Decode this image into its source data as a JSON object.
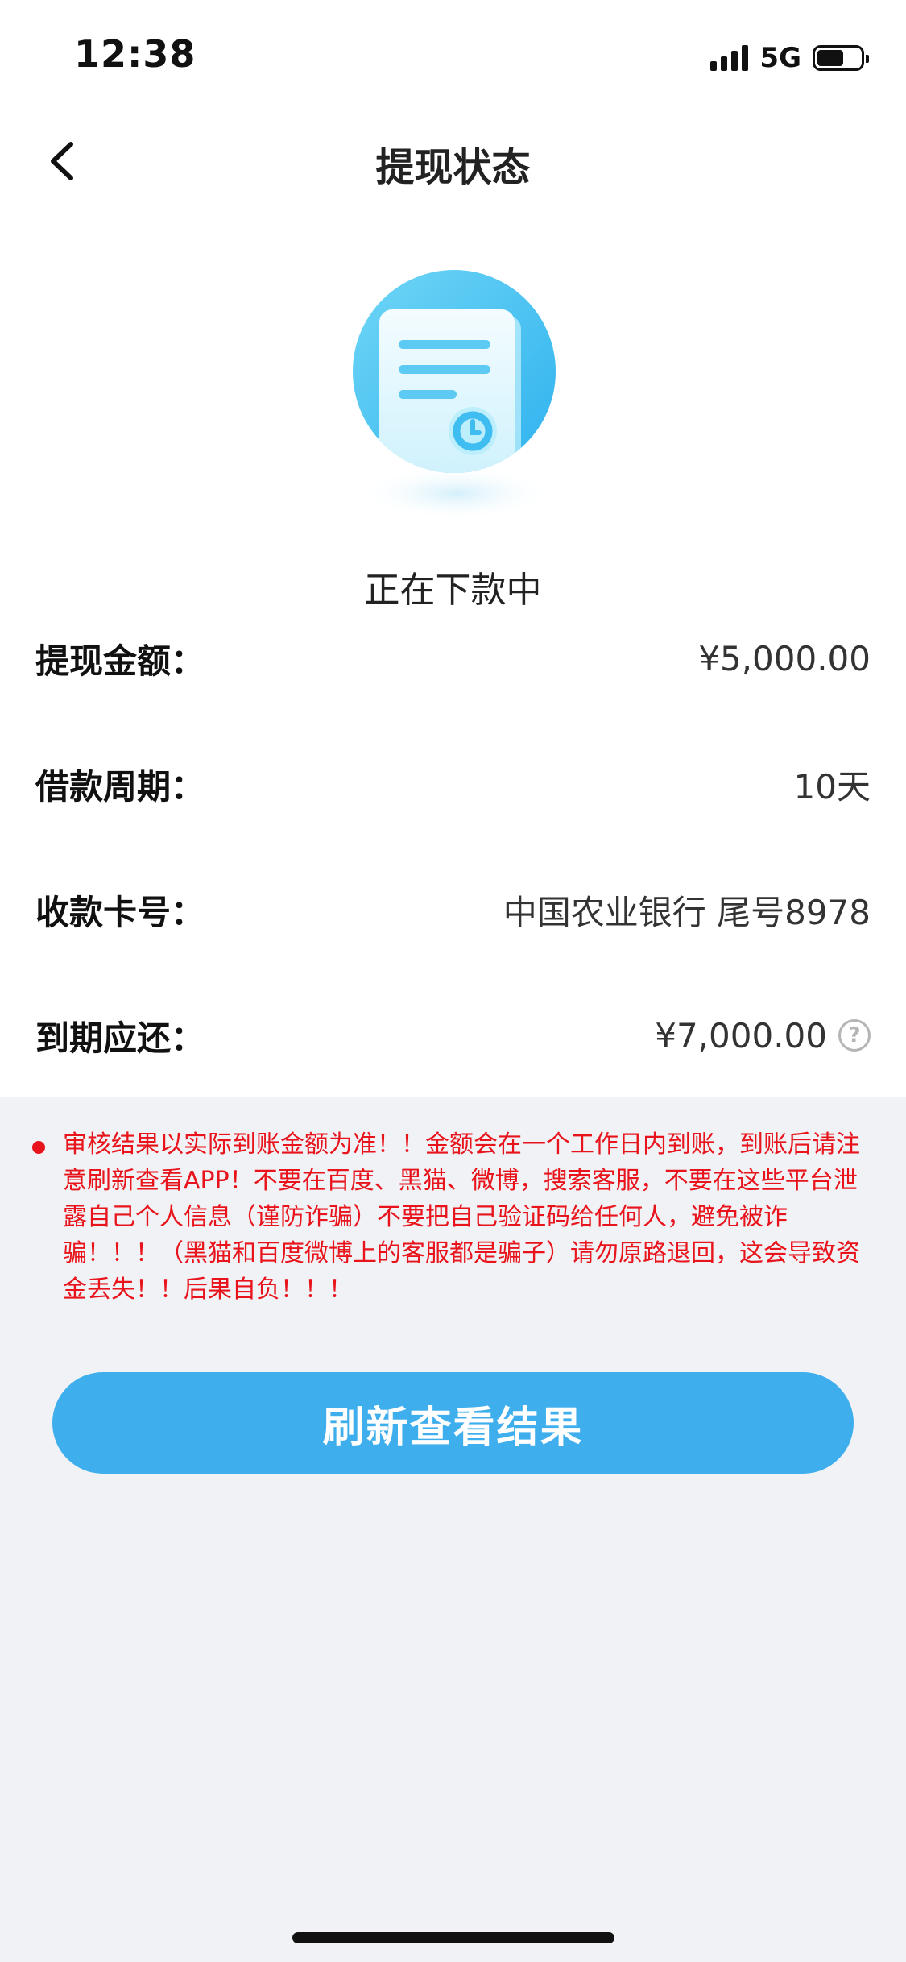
{
  "status_bar": {
    "time": "12:38",
    "network": "5G"
  },
  "nav": {
    "title": "提现状态"
  },
  "status": {
    "icon": "document-clock-icon",
    "text": "正在下款中"
  },
  "info_rows": [
    {
      "label": "提现金额：",
      "value": "¥5,000.00"
    },
    {
      "label": "借款周期：",
      "value": "10天"
    },
    {
      "label": "收款卡号：",
      "value": "中国农业银行 尾号8978"
    },
    {
      "label": "到期应还：",
      "value": "¥7,000.00",
      "icon": "help-circle-icon"
    }
  ],
  "notice": {
    "text": "审核结果以实际到账金额为准！！金额会在一个工作日内到账，到账后请注意刷新查看APP！不要在百度、黑猫、微博，搜索客服，不要在这些平台泄露自己个人信息（谨防诈骗）不要把自己验证码给任何人，避免被诈骗！！！（黑猫和百度微博上的客服都是骗子）请勿原路退回，这会导致资金丢失！！后果自负！！！",
    "color": "#e8131b"
  },
  "actions": {
    "refresh_label": "刷新查看结果",
    "accent": "#3eaeed"
  },
  "help_glyph": "?"
}
